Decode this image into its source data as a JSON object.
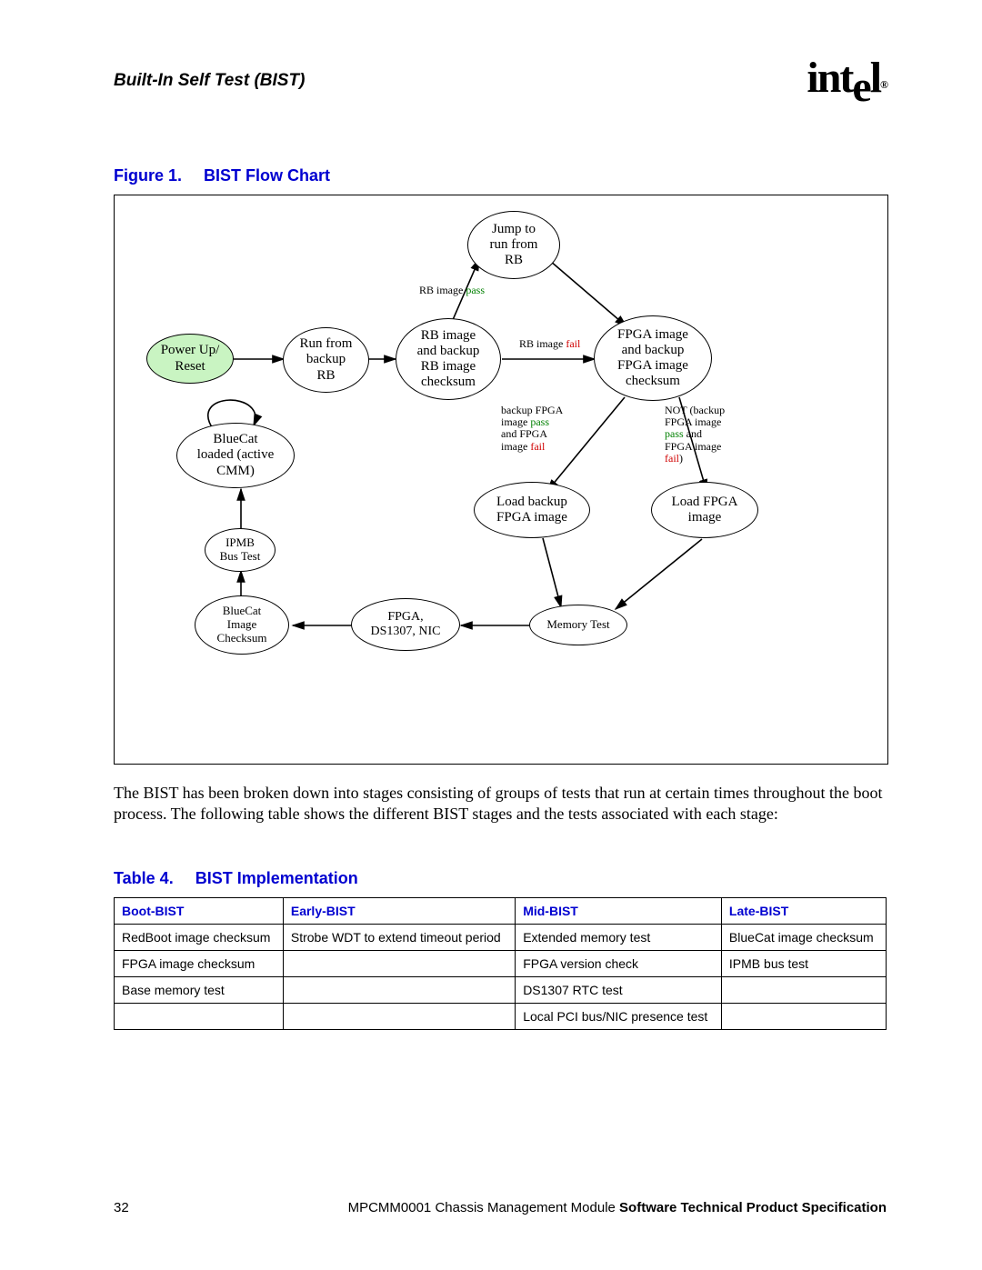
{
  "header": {
    "section_title": "Built-In Self Test (BIST)",
    "logo_text": "intel",
    "logo_reg": "®"
  },
  "figure": {
    "label": "Figure 1.",
    "title": "BIST Flow Chart",
    "nodes": {
      "jump": "Jump to\nrun from\nRB",
      "power": "Power Up/\nReset",
      "runrb": "Run from\nbackup\nRB",
      "rbchk": "RB image\nand backup\nRB image\nchecksum",
      "fpgachk": "FPGA image\nand backup\nFPGA image\nchecksum",
      "bluecat": "BlueCat\nloaded (active\nCMM)",
      "ipmb": "IPMB\nBus Test",
      "bcchk": "BlueCat\nImage\nChecksum",
      "fpgads": "FPGA,\nDS1307, NIC",
      "memtst": "Memory Test",
      "ldbfpga": "Load backup\nFPGA image",
      "ldfpga": "Load FPGA\nimage"
    },
    "edge_labels": {
      "rb_pass": {
        "pre": "RB image ",
        "suf": "pass"
      },
      "rb_fail": {
        "pre": "RB image ",
        "suf": "fail"
      },
      "branch_left": {
        "l1": "backup FPGA",
        "l2pre": "image ",
        "l2suf": "pass",
        "l3": "and FPGA",
        "l4pre": "image ",
        "l4suf": "fail"
      },
      "branch_right": {
        "l1": "NOT (backup",
        "l2": "FPGA image",
        "l3pre": "",
        "l3word": "pass",
        "l3suf": " and",
        "l4": "FPGA image",
        "l5word": "fail",
        "l5suf": ")"
      }
    }
  },
  "paragraph": "The BIST has been broken down into stages consisting of groups of tests that run at certain times throughout the boot process. The following table shows the different BIST stages and the tests associated with each stage:",
  "table": {
    "label": "Table 4.",
    "title": "BIST Implementation",
    "headers": [
      "Boot-BIST",
      "Early-BIST",
      "Mid-BIST",
      "Late-BIST"
    ],
    "rows": [
      [
        "RedBoot image checksum",
        "Strobe WDT to extend timeout period",
        "Extended memory test",
        "BlueCat image checksum"
      ],
      [
        "FPGA image checksum",
        "",
        "FPGA version check",
        "IPMB bus test"
      ],
      [
        "Base memory test",
        "",
        "DS1307 RTC test",
        ""
      ],
      [
        "",
        "",
        "Local PCI bus/NIC presence test",
        ""
      ]
    ]
  },
  "footer": {
    "page_number": "32",
    "doc_id": "MPCMM0001 Chassis Management Module ",
    "doc_title": "Software Technical Product Specification"
  }
}
